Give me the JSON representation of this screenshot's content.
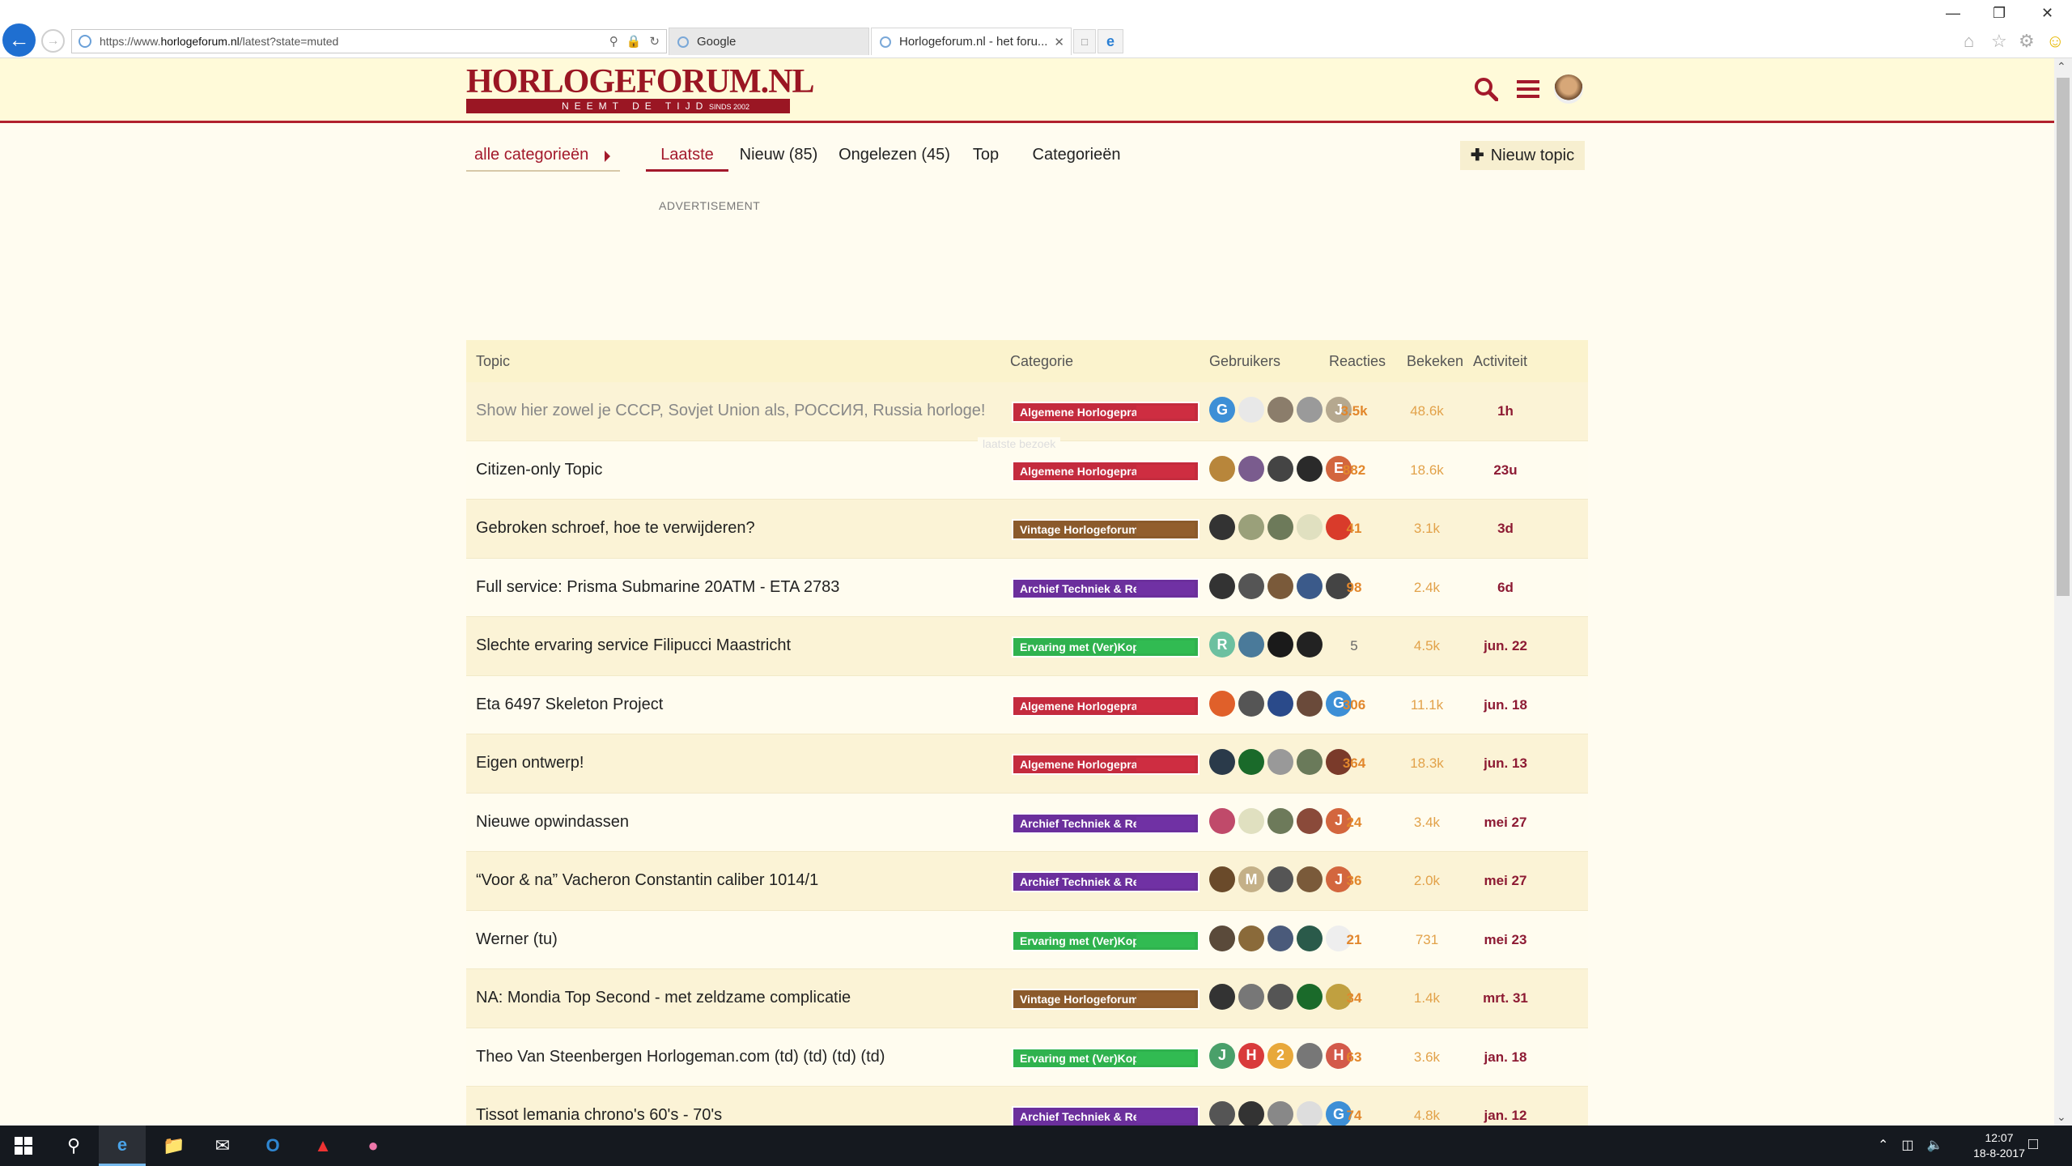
{
  "browser": {
    "url_prefix": "https://www.",
    "url_host": "horlogeforum.nl",
    "url_path": "/latest?state=muted",
    "tabs": [
      {
        "label": "Google"
      },
      {
        "label": "Horlogeforum.nl - het foru..."
      }
    ]
  },
  "site": {
    "logo_word": "HORLOGEFORUM.NL",
    "logo_tagline": "NEEMT DE TIJD",
    "logo_since": "SINDS 2002"
  },
  "nav": {
    "category_dropdown": "alle categorieën",
    "latest": "Laatste",
    "new": "Nieuw (85)",
    "unread": "Ongelezen (45)",
    "top": "Top",
    "categories": "Categorieën",
    "new_topic": "Nieuw topic"
  },
  "ad_label": "ADVERTISEMENT",
  "table": {
    "headers": {
      "topic": "Topic",
      "category": "Categorie",
      "users": "Gebruikers",
      "reactions": "Reacties",
      "views": "Bekeken",
      "activity": "Activiteit"
    },
    "last_visit": "laatste bezoek",
    "rows": [
      {
        "title": "Show hier zowel je CCCP, Sovjet Union als, РОССИЯ, Russia horloge!",
        "category": "Algemene Horlogepraat",
        "reactions": "3.5k",
        "views": "48.6k",
        "activity": "1h",
        "avatars": [
          {
            "letter": "G",
            "color": "#3d8fd6"
          },
          {
            "letter": "",
            "color": "#e8e8e8"
          },
          {
            "letter": "",
            "color": "#8b7d6b"
          },
          {
            "letter": "",
            "color": "#9a9a9a"
          },
          {
            "letter": "J",
            "color": "#b5a88f"
          }
        ]
      },
      {
        "title": "Citizen-only Topic",
        "category": "Algemene Horlogepraat",
        "reactions": "882",
        "views": "18.6k",
        "activity": "23u",
        "avatars": [
          {
            "letter": "",
            "color": "#b8863b"
          },
          {
            "letter": "",
            "color": "#7a5c8e"
          },
          {
            "letter": "",
            "color": "#444"
          },
          {
            "letter": "",
            "color": "#2a2a2a"
          },
          {
            "letter": "E",
            "color": "#d3663e"
          }
        ]
      },
      {
        "title": "Gebroken schroef, hoe te verwijderen?",
        "category": "Vintage Horlogeforum",
        "reactions": "41",
        "views": "3.1k",
        "activity": "3d",
        "avatars": [
          {
            "letter": "",
            "color": "#333"
          },
          {
            "letter": "",
            "color": "#9aa07a"
          },
          {
            "letter": "",
            "color": "#6d7a5a"
          },
          {
            "letter": "",
            "color": "#e0e0c0"
          },
          {
            "letter": "",
            "color": "#d93b2b"
          }
        ]
      },
      {
        "title": "Full service: Prisma Submarine 20ATM - ETA 2783",
        "category": "Archief Techniek & Reviews",
        "reactions": "98",
        "views": "2.4k",
        "activity": "6d",
        "avatars": [
          {
            "letter": "",
            "color": "#333"
          },
          {
            "letter": "",
            "color": "#555"
          },
          {
            "letter": "",
            "color": "#7a5a3a"
          },
          {
            "letter": "",
            "color": "#3b5a8a"
          },
          {
            "letter": "",
            "color": "#444"
          }
        ]
      },
      {
        "title": "Slechte ervaring service Filipucci Maastricht",
        "category": "Ervaring met (Ver)Kopers",
        "reactions": "5",
        "views": "4.5k",
        "activity": "jun. 22",
        "avatars": [
          {
            "letter": "R",
            "color": "#6cc0a0"
          },
          {
            "letter": "",
            "color": "#4a7a9a"
          },
          {
            "letter": "",
            "color": "#1a1a1a"
          },
          {
            "letter": "",
            "color": "#222"
          }
        ]
      },
      {
        "title": "Eta 6497 Skeleton Project",
        "category": "Algemene Horlogepraat",
        "reactions": "306",
        "views": "11.1k",
        "activity": "jun. 18",
        "avatars": [
          {
            "letter": "",
            "color": "#e0602a"
          },
          {
            "letter": "",
            "color": "#555"
          },
          {
            "letter": "",
            "color": "#2a4a8a"
          },
          {
            "letter": "",
            "color": "#6a4a3a"
          },
          {
            "letter": "G",
            "color": "#3d8fd6"
          }
        ]
      },
      {
        "title": "Eigen ontwerp!",
        "category": "Algemene Horlogepraat",
        "reactions": "364",
        "views": "18.3k",
        "activity": "jun. 13",
        "avatars": [
          {
            "letter": "",
            "color": "#2a3a4a"
          },
          {
            "letter": "",
            "color": "#1a6a2a"
          },
          {
            "letter": "",
            "color": "#999"
          },
          {
            "letter": "",
            "color": "#6a7a5a"
          },
          {
            "letter": "",
            "color": "#7a3a2a"
          }
        ]
      },
      {
        "title": "Nieuwe opwindassen",
        "category": "Archief Techniek & Reviews",
        "reactions": "24",
        "views": "3.4k",
        "activity": "mei 27",
        "avatars": [
          {
            "letter": "",
            "color": "#c04a6a"
          },
          {
            "letter": "",
            "color": "#e0e0c0"
          },
          {
            "letter": "",
            "color": "#6d7a5a"
          },
          {
            "letter": "",
            "color": "#8a4a3a"
          },
          {
            "letter": "J",
            "color": "#d3663e"
          }
        ]
      },
      {
        "title": "“Voor & na” Vacheron Constantin caliber 1014/1",
        "category": "Archief Techniek & Reviews",
        "reactions": "36",
        "views": "2.0k",
        "activity": "mei 27",
        "avatars": [
          {
            "letter": "",
            "color": "#6a4a2a"
          },
          {
            "letter": "M",
            "color": "#c4b088"
          },
          {
            "letter": "",
            "color": "#555"
          },
          {
            "letter": "",
            "color": "#7a5a3a"
          },
          {
            "letter": "J",
            "color": "#d3663e"
          }
        ]
      },
      {
        "title": "Werner (tu)",
        "category": "Ervaring met (Ver)Kopers",
        "reactions": "21",
        "views": "731",
        "activity": "mei 23",
        "avatars": [
          {
            "letter": "",
            "color": "#5a4a3a"
          },
          {
            "letter": "",
            "color": "#8a6a3a"
          },
          {
            "letter": "",
            "color": "#4a5a7a"
          },
          {
            "letter": "",
            "color": "#2a5a4a"
          },
          {
            "letter": "",
            "color": "#eee"
          }
        ]
      },
      {
        "title": "NA: Mondia Top Second - met zeldzame complicatie",
        "category": "Vintage Horlogeforum",
        "reactions": "34",
        "views": "1.4k",
        "activity": "mrt. 31",
        "avatars": [
          {
            "letter": "",
            "color": "#333"
          },
          {
            "letter": "",
            "color": "#777"
          },
          {
            "letter": "",
            "color": "#555"
          },
          {
            "letter": "",
            "color": "#1a6a2a"
          },
          {
            "letter": "",
            "color": "#c0a040"
          }
        ]
      },
      {
        "title": "Theo Van Steenbergen Horlogeman.com (td) (td) (td) (td)",
        "category": "Ervaring met (Ver)Kopers",
        "reactions": "63",
        "views": "3.6k",
        "activity": "jan. 18",
        "avatars": [
          {
            "letter": "J",
            "color": "#4aa06a"
          },
          {
            "letter": "H",
            "color": "#d93b3b"
          },
          {
            "letter": "2",
            "color": "#e8a83a"
          },
          {
            "letter": "",
            "color": "#777"
          },
          {
            "letter": "H",
            "color": "#d35a4a"
          }
        ]
      },
      {
        "title": "Tissot lemania chrono's 60's - 70's",
        "category": "Archief Techniek & Reviews",
        "reactions": "74",
        "views": "4.8k",
        "activity": "jan. 12",
        "avatars": [
          {
            "letter": "",
            "color": "#555"
          },
          {
            "letter": "",
            "color": "#333"
          },
          {
            "letter": "",
            "color": "#888"
          },
          {
            "letter": "",
            "color": "#ddd"
          },
          {
            "letter": "G",
            "color": "#3d8fd6"
          }
        ]
      }
    ]
  },
  "taskbar": {
    "time": "12:07",
    "date": "18-8-2017"
  }
}
